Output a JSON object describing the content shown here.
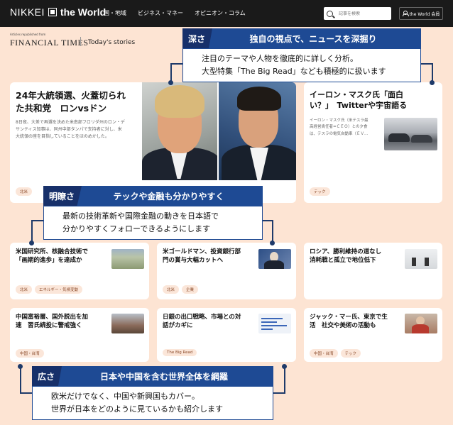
{
  "header": {
    "logo_nikkei": "NIKKEI",
    "logo_world": "the World",
    "nav": [
      "国・地域",
      "ビジネス・マネー",
      "オピニオン・コラム"
    ],
    "search_placeholder": "記事を検索",
    "member_label": "the World 会員"
  },
  "subheader": {
    "republished": "Articles republished from",
    "ft_name": "FINANCIAL TIMES",
    "section": "Today's stories"
  },
  "lead": {
    "title": [
      "24年大統領選、火蓋切られ",
      "た共和党　ロンvsドン"
    ],
    "desc": [
      "8日夜、大差で再選を決めた米南部フロリダ州のロン・デ",
      "サンティス知事は、同州中部タンパで支持者に対し、米",
      "大統領の座を目指していることをほのめかした。"
    ],
    "tags": [
      "北米"
    ]
  },
  "musk": {
    "title": [
      "イーロン・マスク氏「面白",
      "い？」　Twitterや宇宙語る"
    ],
    "desc": [
      "イーロン・マスク氏（米テスラ最",
      "高経営責任者=ＣＥＯ）との夕食",
      "は、テスラの電気自動車（ＥＶ…"
    ],
    "tags": [
      "テック"
    ]
  },
  "grid": [
    {
      "title": [
        "米国研究所、核融合技術で",
        "「画期的進歩」を達成か"
      ],
      "tags": [
        "北米",
        "エネルギー・気候変動"
      ]
    },
    {
      "title": [
        "米ゴールドマン、投資銀行部",
        "門の賞与大幅カットへ"
      ],
      "tags": [
        "北米",
        "企業"
      ]
    },
    {
      "title": [
        "ロシア、勝利維持の道なし",
        "消耗戦と孤立で地位低下"
      ],
      "tags": []
    },
    {
      "title": [
        "中国富裕層、国外脱出を加",
        "速　習氏続投に警戒強く"
      ],
      "tags": [
        "中国・台湾"
      ]
    },
    {
      "title": [
        "日銀の出口戦略、市場との対",
        "話がカギに"
      ],
      "tags": [
        "The Big Read"
      ]
    },
    {
      "title": [
        "ジャック・マー氏、東京で生",
        "活　社交や美術の活動も"
      ],
      "tags": [
        "中国・台湾",
        "テック"
      ]
    }
  ],
  "callouts": [
    {
      "key": "深さ",
      "title": "独自の視点で、ニュースを深掘り",
      "body": [
        "注目のテーマや人物を徹底的に詳しく分析。",
        "大型特集「The Big Read」なども積極的に扱います"
      ]
    },
    {
      "key": "明瞭さ",
      "title": "テックや金融も分かりやすく",
      "body": [
        "最新の技術革新や国際金融の動きを日本語で",
        "分かりやすくフォローできるようにします"
      ]
    },
    {
      "key": "広さ",
      "title": "日本や中国を含む世界全体を網羅",
      "body": [
        "欧米だけでなく、中国や新興国もカバー。",
        "世界が日本をどのように見ているかも紹介します"
      ]
    }
  ],
  "colors": {
    "background": "#fde4d3",
    "header": "#1a1a1a",
    "callout_blue": "#1e4a94",
    "callout_key": "#17306a",
    "tag_bg": "#fbe6d9"
  }
}
